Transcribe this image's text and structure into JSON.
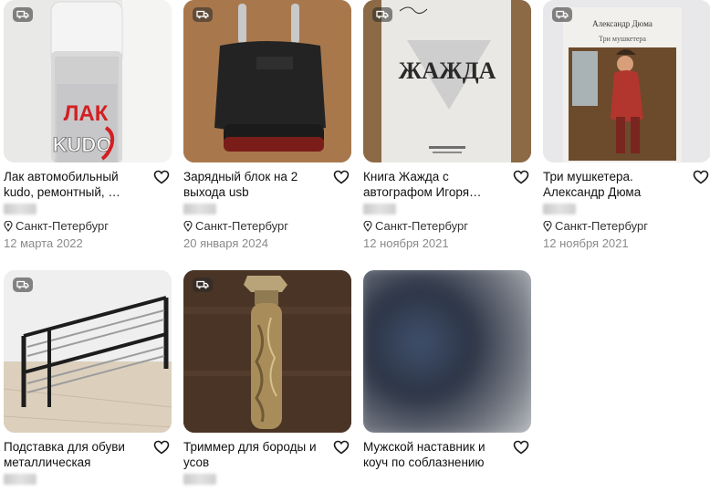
{
  "listings": [
    {
      "title": "Лак автомобильный kudo, ремонтный, …",
      "location": "Санкт-Петербург",
      "date": "12 марта 2022",
      "has_delivery": true,
      "favorite_icon": "heart-outline-icon",
      "delivery_icon": "truck-icon",
      "image_label": "ЛАК",
      "image_brand": "KUDO"
    },
    {
      "title": "Зарядный блок на 2 выхода usb",
      "location": "Санкт-Петербург",
      "date": "20 января 2024",
      "has_delivery": true,
      "favorite_icon": "heart-outline-icon",
      "delivery_icon": "truck-icon"
    },
    {
      "title": "Книга Жажда с автографом Игоря…",
      "location": "Санкт-Петербург",
      "date": "12 ноября 2021",
      "has_delivery": true,
      "favorite_icon": "heart-outline-icon",
      "delivery_icon": "truck-icon",
      "image_label": "ЖАЖДА"
    },
    {
      "title": "Три мушкетера. Александр Дюма",
      "location": "Санкт-Петербург",
      "date": "12 ноября 2021",
      "has_delivery": true,
      "favorite_icon": "heart-outline-icon",
      "delivery_icon": "truck-icon",
      "image_author": "Александр Дюма",
      "image_book": "Три мушкетера"
    },
    {
      "title": "Подставка для обуви металлическая",
      "has_delivery": true,
      "favorite_icon": "heart-outline-icon",
      "delivery_icon": "truck-icon"
    },
    {
      "title": "Триммер для бороды и усов",
      "has_delivery": true,
      "favorite_icon": "heart-outline-icon",
      "delivery_icon": "truck-icon"
    },
    {
      "title": "Мужской наставник и коуч по соблазнению",
      "has_delivery": false,
      "favorite_icon": "heart-outline-icon"
    }
  ],
  "colors": {
    "accent_badge": "#3a3a3a",
    "date_text": "#8a8a8a"
  }
}
